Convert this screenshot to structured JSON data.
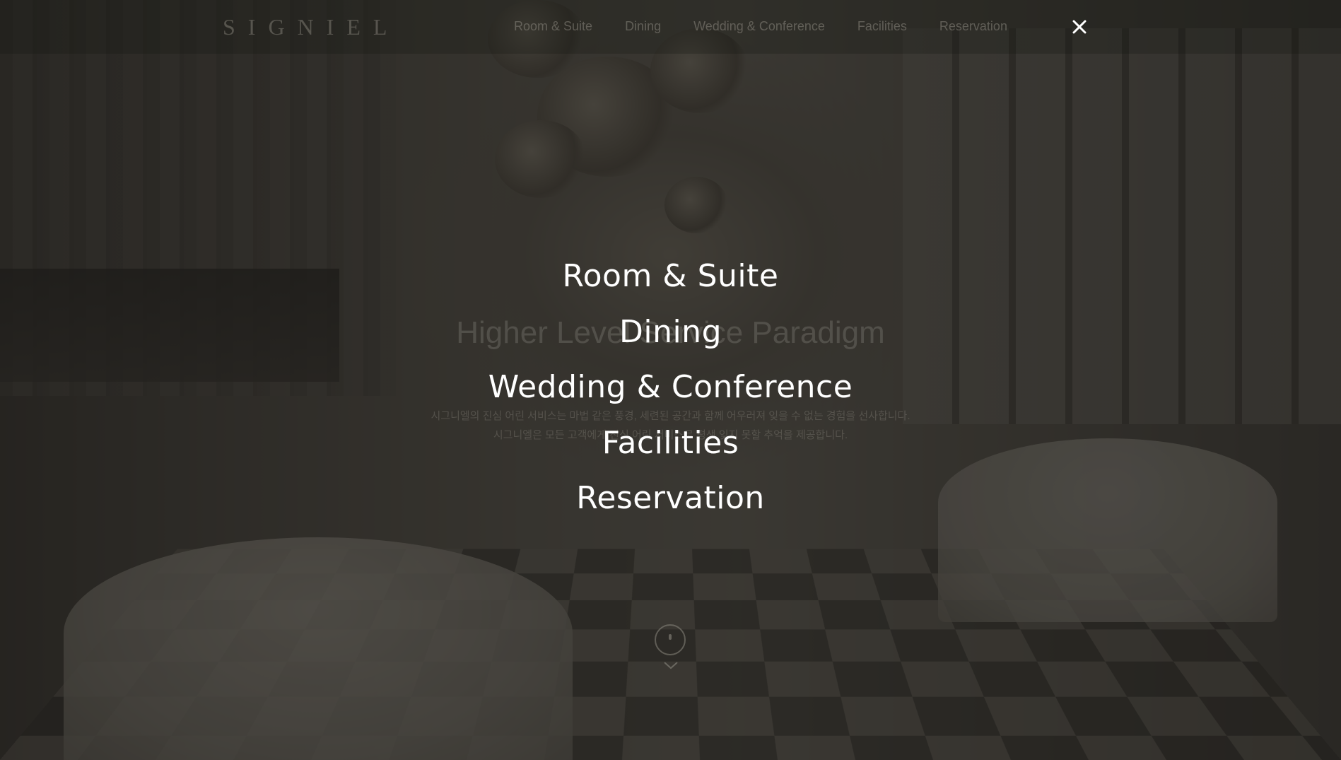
{
  "header": {
    "logo": "SIGNIEL",
    "nav": [
      "Room & Suite",
      "Dining",
      "Wedding & Conference",
      "Facilities",
      "Reservation"
    ],
    "close_icon": "close-icon"
  },
  "hero": {
    "title": "Higher Level Service Paradigm",
    "line1": "시그니엘의 진심 어린 서비스는 마법 같은 풍경, 세련된 공간과 함께 어우러져 잊을 수 없는 경험을 선사합니다.",
    "line2": "시그니엘은 모든 고객에게 진심 어린 서비스로 평생 잊지 못할 추억을 제공합니다."
  },
  "menu": {
    "items": [
      "Room & Suite",
      "Dining",
      "Wedding & Conference",
      "Facilities",
      "Reservation"
    ]
  },
  "scroll": {
    "icon": "mouse-scroll-icon",
    "chevron": "chevron-down-icon"
  },
  "colors": {
    "overlay": "#1a1816",
    "menu_text": "#ffffff"
  }
}
